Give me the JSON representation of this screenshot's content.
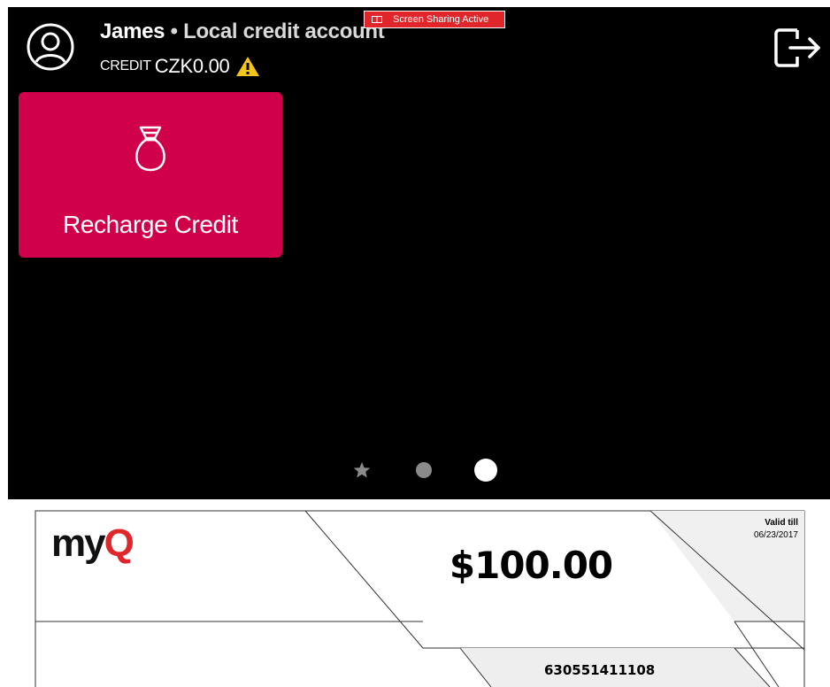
{
  "header": {
    "user_name": "James",
    "separator": " • ",
    "account_type": "Local credit account",
    "credit_label": "CREDIT",
    "credit_value": "CZK0.00",
    "warning_icon": "warning-icon",
    "avatar_icon": "user-circle-icon",
    "logout_icon": "logout-icon"
  },
  "screen_sharing": {
    "label": "Screen Sharing Active",
    "icon": "screen-share-icon"
  },
  "tiles": [
    {
      "label": "Recharge Credit",
      "icon": "money-bag-icon"
    }
  ],
  "pager": {
    "pages": [
      "favorites",
      "page-2",
      "page-3"
    ],
    "active_index": 2
  },
  "voucher": {
    "logo": {
      "my": "my",
      "q": "Q"
    },
    "amount": "$100.00",
    "valid_label": "Valid till",
    "valid_date": "06/23/2017",
    "code": "630551411108"
  },
  "colors": {
    "screen_bg": "#000000",
    "tile_bg": "#d0004a",
    "warning": "#f5c518",
    "share_badge": "#e0262b",
    "logo_accent": "#e0262b",
    "dot_inactive": "#8a8a8a",
    "dot_active": "#ffffff"
  }
}
